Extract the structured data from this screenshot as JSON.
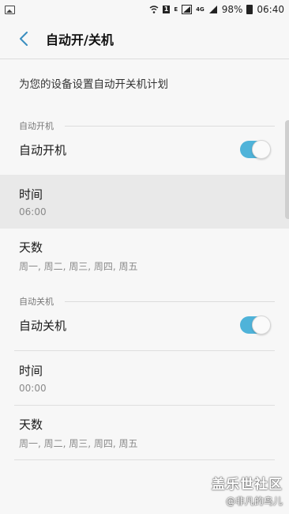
{
  "status_bar": {
    "sim_badge": "1",
    "network_e": "E",
    "network_4g": "4G",
    "battery": "98%",
    "time": "06:40"
  },
  "header": {
    "title": "自动开/关机"
  },
  "description": "为您的设备设置自动开关机计划",
  "power_on": {
    "section_title": "自动开机",
    "toggle_label": "自动开机",
    "toggle_on": true,
    "time_label": "时间",
    "time_value": "06:00",
    "days_label": "天数",
    "days_value": "周一, 周二, 周三, 周四, 周五"
  },
  "power_off": {
    "section_title": "自动关机",
    "toggle_label": "自动关机",
    "toggle_on": true,
    "time_label": "时间",
    "time_value": "00:00",
    "days_label": "天数",
    "days_value": "周一, 周二, 周三, 周四, 周五"
  },
  "watermark": {
    "line1": "盖乐世社区",
    "line2": "@非凡的鸟儿"
  },
  "colors": {
    "accent": "#4fb3d9",
    "background": "#f7f7f7",
    "highlight": "#e9e9e9"
  }
}
